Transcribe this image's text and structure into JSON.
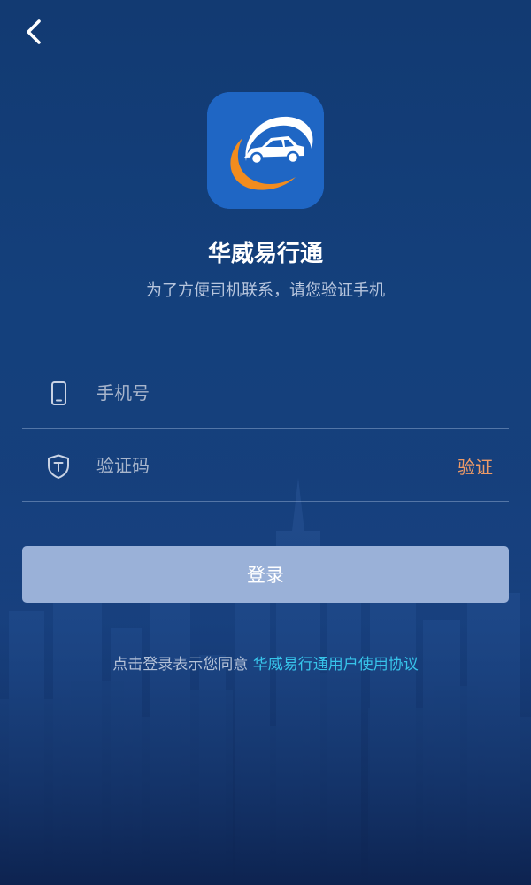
{
  "header": {
    "back_icon": "chevron-left-icon"
  },
  "brand": {
    "logo_icon": "car-logo-icon",
    "title": "华威易行通",
    "subtitle": "为了方便司机联系，请您验证手机"
  },
  "form": {
    "phone": {
      "icon": "phone-icon",
      "placeholder": "手机号",
      "value": ""
    },
    "code": {
      "icon": "shield-icon",
      "placeholder": "验证码",
      "value": "",
      "verify_label": "验证"
    },
    "login_label": "登录"
  },
  "agreement": {
    "prefix": "点击登录表示您同意",
    "link": "华威易行通用户使用协议"
  },
  "colors": {
    "background_top": "#123a72",
    "background_bottom": "#0f2552",
    "button": "#9ab1d8",
    "verify": "#ee9a66",
    "link": "#37c4ea",
    "logo_blue": "#1f66c4",
    "logo_orange": "#f28c1e"
  }
}
